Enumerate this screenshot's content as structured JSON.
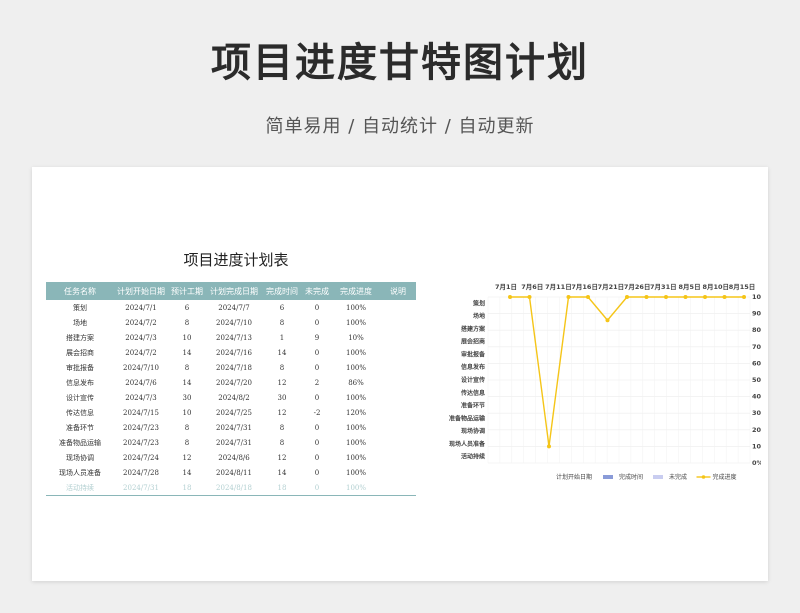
{
  "page": {
    "title": "项目进度甘特图计划",
    "subtitle": "简单易用  /  自动统计  /  自动更新"
  },
  "sheet": {
    "title": "项目进度计划表",
    "columns": [
      "任务名称",
      "计划开始日期",
      "预计工期",
      "计划完成日期",
      "完成时间",
      "未完成",
      "完成进度",
      "说明"
    ],
    "rows": [
      [
        "策划",
        "2024/7/1",
        "6",
        "2024/7/7",
        "6",
        "0",
        "100%",
        ""
      ],
      [
        "场地",
        "2024/7/2",
        "8",
        "2024/7/10",
        "8",
        "0",
        "100%",
        ""
      ],
      [
        "搭建方案",
        "2024/7/3",
        "10",
        "2024/7/13",
        "1",
        "9",
        "10%",
        ""
      ],
      [
        "展会招商",
        "2024/7/2",
        "14",
        "2024/7/16",
        "14",
        "0",
        "100%",
        ""
      ],
      [
        "审批报备",
        "2024/7/10",
        "8",
        "2024/7/18",
        "8",
        "0",
        "100%",
        ""
      ],
      [
        "信息发布",
        "2024/7/6",
        "14",
        "2024/7/20",
        "12",
        "2",
        "86%",
        ""
      ],
      [
        "设计宣传",
        "2024/7/3",
        "30",
        "2024/8/2",
        "30",
        "0",
        "100%",
        ""
      ],
      [
        "传达信息",
        "2024/7/15",
        "10",
        "2024/7/25",
        "12",
        "-2",
        "120%",
        ""
      ],
      [
        "准备环节",
        "2024/7/23",
        "8",
        "2024/7/31",
        "8",
        "0",
        "100%",
        ""
      ],
      [
        "准备物品运输",
        "2024/7/23",
        "8",
        "2024/7/31",
        "8",
        "0",
        "100%",
        ""
      ],
      [
        "现场协调",
        "2024/7/24",
        "12",
        "2024/8/6",
        "12",
        "0",
        "100%",
        ""
      ],
      [
        "现场人员准备",
        "2024/7/28",
        "14",
        "2024/8/11",
        "14",
        "0",
        "100%",
        ""
      ],
      [
        "活动持续",
        "2024/7/31",
        "18",
        "2024/8/18",
        "18",
        "0",
        "100%",
        ""
      ]
    ]
  },
  "chart_data": {
    "type": "line",
    "x_top_labels": [
      "7月1日",
      "7月6日",
      "7月11日",
      "7月16日",
      "7月21日",
      "7月26日",
      "7月31日",
      "8月5日",
      "8月10日",
      "8月15日"
    ],
    "categories": [
      "策划",
      "场地",
      "搭建方案",
      "展会招商",
      "审批报备",
      "信息发布",
      "设计宣传",
      "传达信息",
      "准备环节",
      "准备物品运输",
      "现场协调",
      "现场人员准备",
      "活动持续"
    ],
    "right_axis_labels": [
      "100%",
      "90%",
      "80%",
      "70%",
      "60%",
      "50%",
      "40%",
      "30%",
      "20%",
      "10%",
      "0%"
    ],
    "ylim": [
      0,
      1
    ],
    "series": [
      {
        "name": "完成进度",
        "color": "#f5c518",
        "values": [
          1,
          1,
          0.1,
          1,
          1,
          0.86,
          1,
          1.2,
          1,
          1,
          1,
          1,
          1
        ]
      }
    ],
    "legend": [
      {
        "name": "计划开始日期",
        "color": "#ffffff"
      },
      {
        "name": "完成时间",
        "color": "#8a9bd8"
      },
      {
        "name": "未完成",
        "color": "#c9cdf0"
      },
      {
        "name": "完成进度",
        "color": "#f5c518"
      }
    ],
    "legend_position": "bottom",
    "grid": true
  }
}
